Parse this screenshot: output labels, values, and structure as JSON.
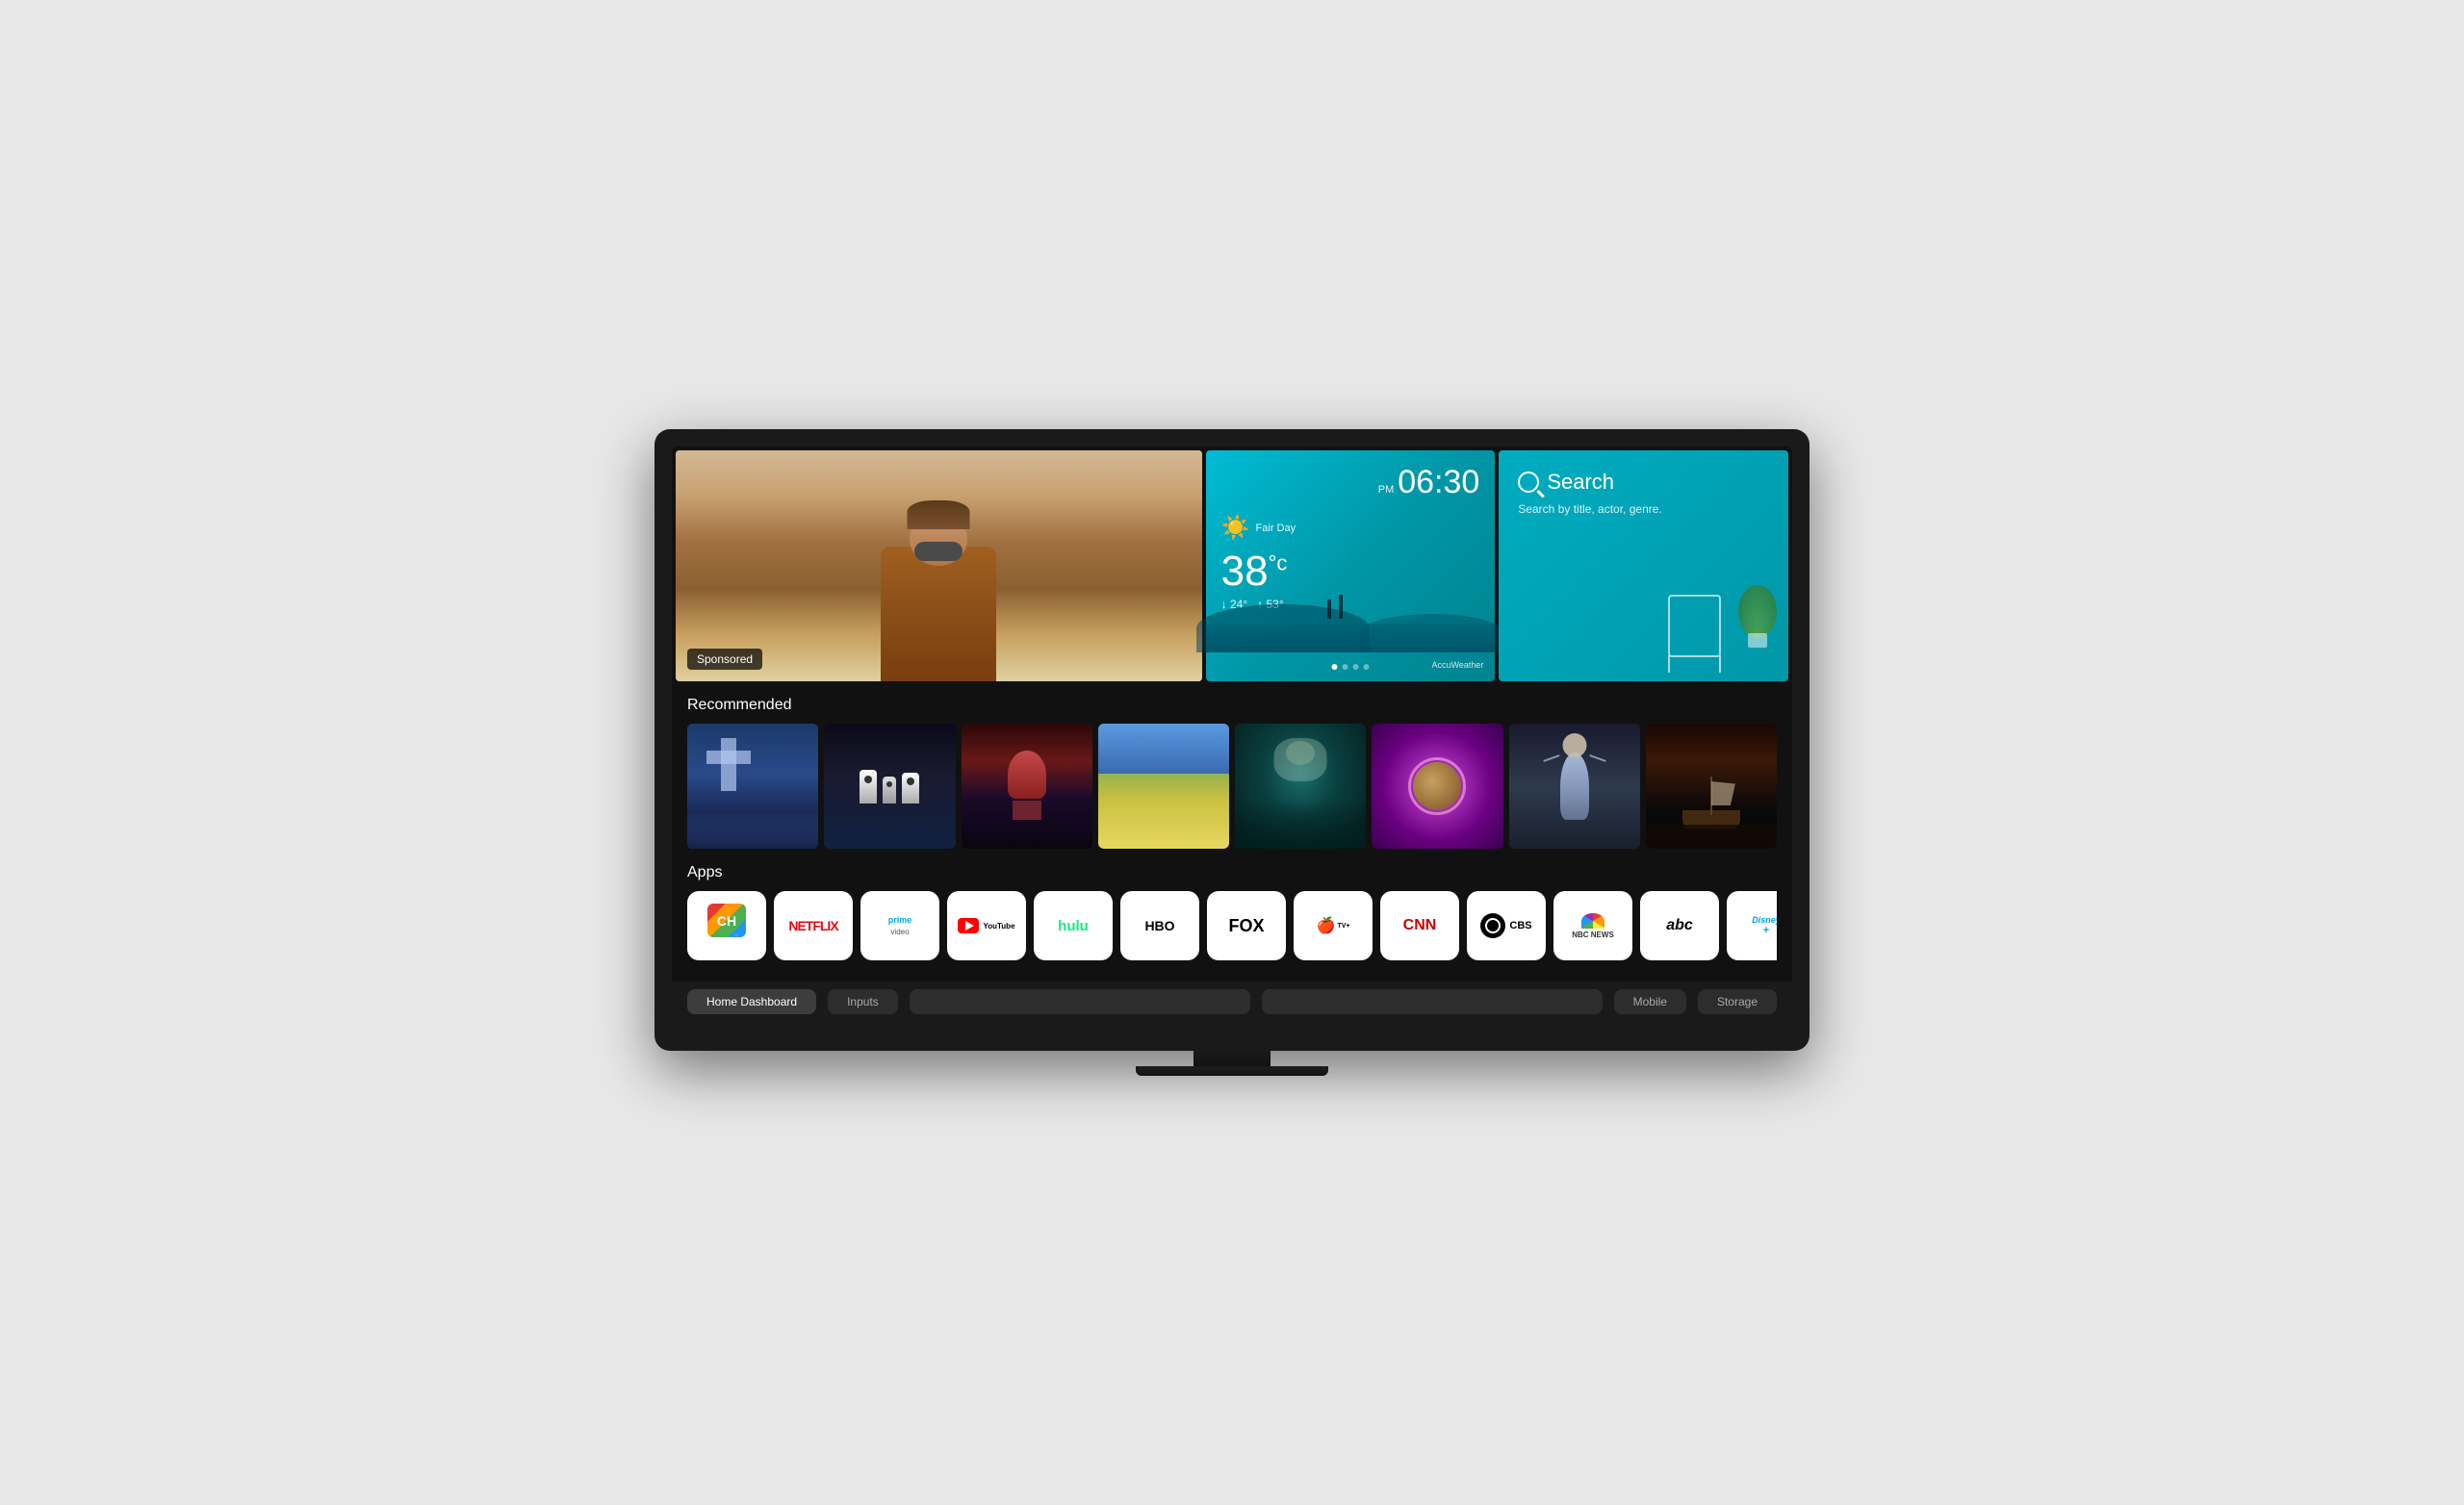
{
  "tv": {
    "hero": {
      "sponsored_label": "Sponsored",
      "weather": {
        "period": "PM",
        "time": "06:30",
        "condition": "Fair Day",
        "temp": "38",
        "temp_unit": "°c",
        "low": "↓ 24°",
        "high": "↑ 53°",
        "provider": "AccuWeather"
      },
      "search": {
        "title": "Search",
        "subtitle": "Search by title, actor, genre."
      }
    },
    "recommended": {
      "section_title": "Recommended",
      "items": [
        {
          "id": 1,
          "alt": "Cross monument scene"
        },
        {
          "id": 2,
          "alt": "Penguins"
        },
        {
          "id": 3,
          "alt": "Red-haired woman"
        },
        {
          "id": 4,
          "alt": "Wheat field"
        },
        {
          "id": 5,
          "alt": "Skull underwater"
        },
        {
          "id": 6,
          "alt": "Woman with flowers"
        },
        {
          "id": 7,
          "alt": "Athlete silhouette"
        },
        {
          "id": 8,
          "alt": "Pirate ship"
        }
      ]
    },
    "apps": {
      "section_title": "Apps",
      "items": [
        {
          "id": "ch",
          "label": "CH"
        },
        {
          "id": "netflix",
          "label": "NETFLIX"
        },
        {
          "id": "prime",
          "label": "prime\nvideo"
        },
        {
          "id": "youtube",
          "label": "YouTube"
        },
        {
          "id": "hulu",
          "label": "hulu"
        },
        {
          "id": "hbo",
          "label": "HBO"
        },
        {
          "id": "fox",
          "label": "FOX"
        },
        {
          "id": "appletv",
          "label": "Apple TV+"
        },
        {
          "id": "cnn",
          "label": "CNN"
        },
        {
          "id": "cbs",
          "label": "CBS"
        },
        {
          "id": "nbc",
          "label": "NBC NEWS"
        },
        {
          "id": "abc",
          "label": "abc"
        },
        {
          "id": "disney",
          "label": "Disney+"
        }
      ]
    },
    "bottom_nav": {
      "items": [
        {
          "id": "home",
          "label": "Home Dashboard"
        },
        {
          "id": "inputs",
          "label": "Inputs"
        },
        {
          "id": "nav3",
          "label": ""
        },
        {
          "id": "nav4",
          "label": ""
        },
        {
          "id": "mobile",
          "label": "Mobile"
        },
        {
          "id": "storage",
          "label": "Storage"
        }
      ]
    }
  }
}
